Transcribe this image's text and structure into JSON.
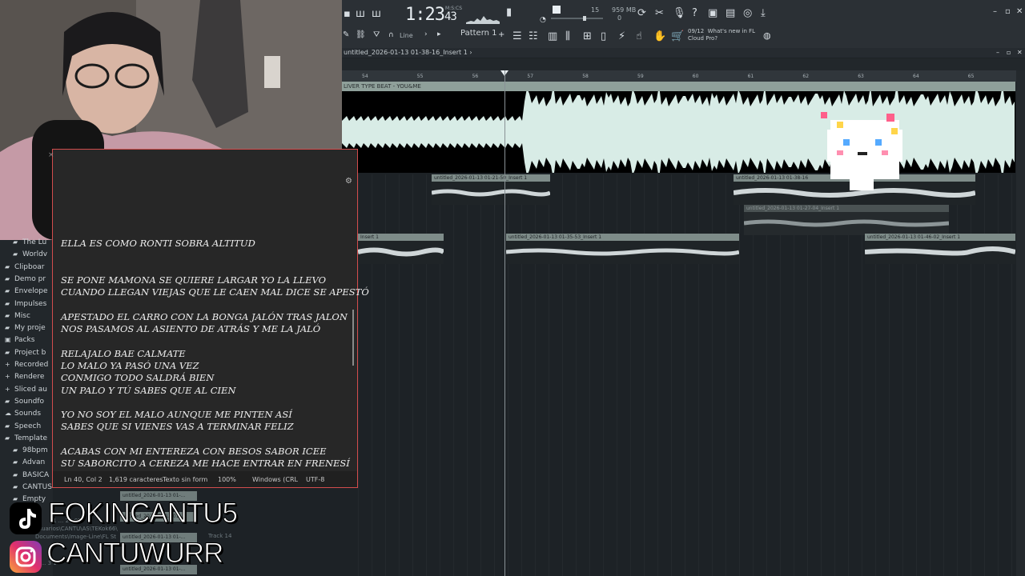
{
  "toolbar": {
    "time_main": "1:23",
    "time_frac": "43",
    "time_unit": "M:S:CS",
    "tempo_value": "15",
    "memory": "959 MB",
    "memory_sub": "0",
    "snap_label": "Line",
    "pattern_label": "Pattern 1",
    "news_counter": "09/12",
    "news_text_1": "What's new in FL",
    "news_text_2": "Cloud Pro?"
  },
  "playlist": {
    "window_title": "untitled_2026-01-13 01-38-16_Insert 1 ›",
    "track_header": "LIVER TYPE BEAT - YOU&ME",
    "ruler": [
      "54",
      "55",
      "56",
      "57",
      "58",
      "59",
      "60",
      "61",
      "62",
      "63",
      "64",
      "65"
    ],
    "clips": [
      "untitled_2026-01-13 01-21-50_Insert 1",
      "untitled_2026-01-13 01-38-16",
      "untitled_2026-01-13 01-27-04_Insert 1",
      "Insert 1",
      "untitled_2026-01-13 01-35-53_Insert 1",
      "untitled_2026-01-13 01-46-02_Insert 1"
    ]
  },
  "browser": {
    "items": [
      "The Lu",
      "Worldv",
      "Clipboar",
      "Demo pr",
      "Envelope",
      "Impulses",
      "Misc",
      "My proje",
      "Packs",
      "Project b",
      "Recorded",
      "Rendere",
      "Sliced au",
      "Soundfo",
      "Sounds",
      "Speech",
      "Template",
      "98bpm",
      "Advan",
      "BASICA",
      "CANTUS",
      "Empty"
    ]
  },
  "notepad": {
    "lyrics": "ELLA ES COMO RONTI SOBRA ALTITUD\n\n\nSE PONE MAMONA SE QUIERE LARGAR YO LA LLEVO\nCUANDO LLEGAN VIEJAS QUE LE CAEN MAL DICE SE APESTÓ\n\nAPESTADO EL CARRO CON LA BONGA JALÓN TRAS JALON\nNOS PASAMOS AL ASIENTO DE ATRÁS Y ME LA JALÓ\n\nRELAJALO BAE CALMATE\nLO MALO YA PASÓ UNA VEZ\nCONMIGO TODO SALDRÁ BIEN\nUN PALO Y TÚ SABES QUE AL CIEN\n\nYO NO SOY EL MALO AUNQUE ME PINTEN ASÍ\nSABES QUE SI VIENES VAS A TERMINAR FELIZ\n\nACABAS CON MI ENTEREZA CON BESOS SABOR ICEE\nSU SABORCITO A CEREZA ME HACE ENTRAR EN FRENESÍ",
    "status": {
      "position": "Ln 40, Col 2",
      "chars": "1,619 caracteres",
      "format": "Texto sin form",
      "zoom": "100%",
      "line_ending": "Windows (CRL",
      "encoding": "UTF-8"
    }
  },
  "overlay": {
    "tiktok_handle": "FOKINCANTU5",
    "instagram_handle": "CANTUWURR",
    "mini_clips": [
      "untitled_2026-01-13 01-...",
      "untitled_2026-01-13 01-...",
      "untitled_2026-01-13 01-...",
      "untitled_2026-01-13 01-..."
    ],
    "track_label": "Track 14",
    "path_fragments": [
      "usuarios\\CANTU\\AS\\TEKok66\\",
      "Documents\\Image-Line\\FL St",
      "1 ... 24 05",
      "1 ... 3 1"
    ]
  },
  "colors": {
    "accent_red": "#d24c4c",
    "wave_fill": "#d8ece6",
    "clip_header": "#7e8c89"
  }
}
